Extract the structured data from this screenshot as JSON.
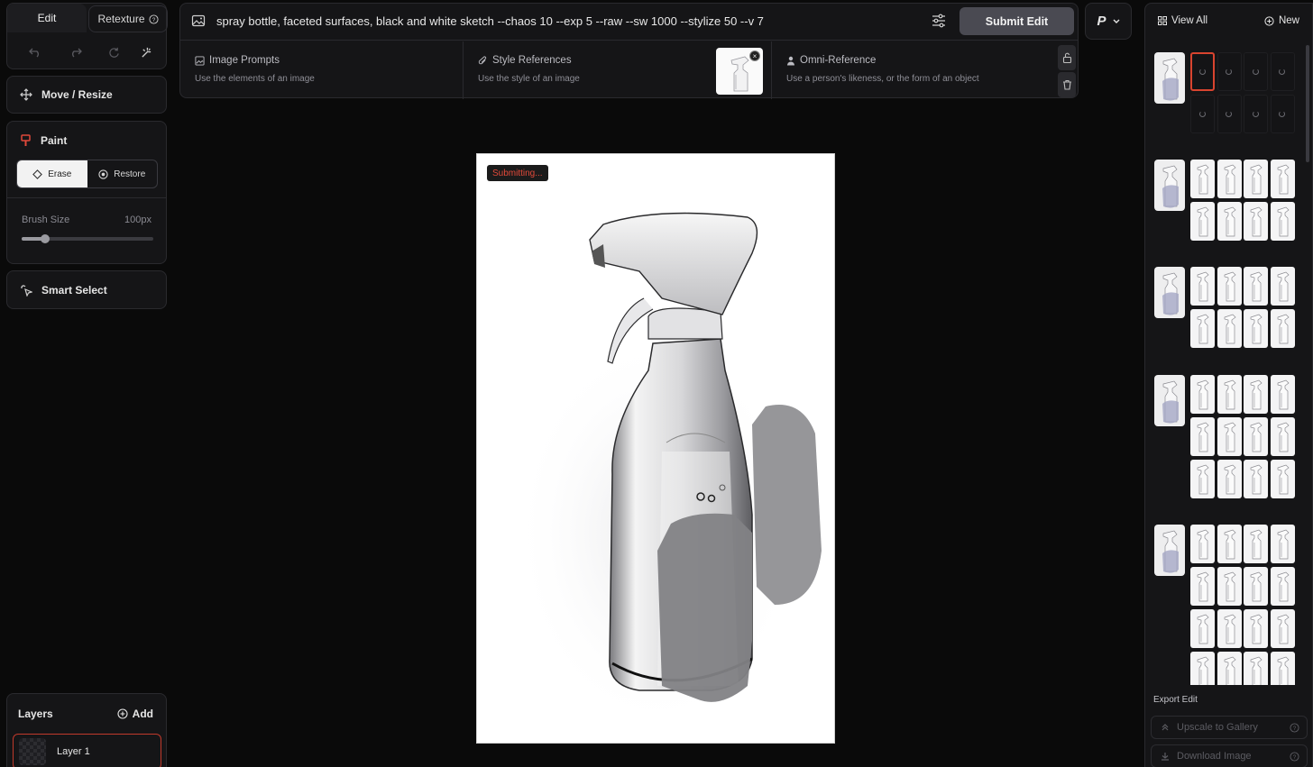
{
  "tools": {
    "tab_edit": "Edit",
    "tab_retexture": "Retexture",
    "move_resize": "Move / Resize",
    "paint": "Paint",
    "erase": "Erase",
    "restore": "Restore",
    "brush_size_label": "Brush Size",
    "brush_size_value": "100px",
    "brush_size_fraction": 0.18,
    "smart_select": "Smart Select"
  },
  "layers": {
    "title": "Layers",
    "add_label": "Add",
    "items": [
      {
        "name": "Layer 1"
      }
    ]
  },
  "prompt": {
    "text": "spray bottle, faceted surfaces, black and white sketch --chaos 10 --exp 5 --raw --sw 1000 --stylize 50 --v 7",
    "submit_label": "Submit Edit",
    "profile_label": "P"
  },
  "references": {
    "image_prompts_title": "Image Prompts",
    "image_prompts_desc": "Use the elements of an image",
    "style_refs_title": "Style References",
    "style_refs_desc": "Use the style of an image",
    "omni_title": "Omni-Reference",
    "omni_desc": "Use a person's likeness, or the form of an object"
  },
  "canvas": {
    "status": "Submitting..."
  },
  "gallery": {
    "view_all": "View All",
    "new_label": "New",
    "export_label": "Export Edit",
    "upscale_label": "Upscale to Gallery",
    "download_label": "Download Image"
  },
  "colors": {
    "accent": "#d9442f",
    "background": "#0a0a0a",
    "panel": "#151517"
  }
}
